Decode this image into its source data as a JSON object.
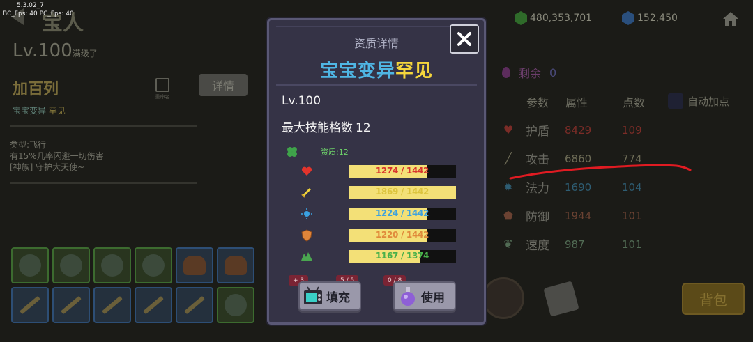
{
  "debug": {
    "version": "5.3.02_7",
    "fps": "BC_Fps: 40   PC_Fps: 40"
  },
  "background": {
    "title": "宝人",
    "currency": {
      "gold": "480,353,701",
      "gems": "152,450"
    },
    "pet": {
      "level": "Lv.100",
      "level_note": "满级了",
      "name": "加百列",
      "rename_label": "重命名",
      "detail_label": "详情",
      "subtitle": "宝宝变异",
      "subtitle_rare": "罕见",
      "desc": [
        "类型:飞行",
        "有15%几率闪避一切伤害",
        "[神族] 守护大天使~"
      ]
    },
    "attributes": {
      "remain_label": "剩余",
      "remain_value": "0",
      "headers": [
        "参数",
        "属性",
        "点数"
      ],
      "auto_add_label": "自动加点",
      "rows": [
        {
          "icon": "heart-icon",
          "name": "护盾",
          "value": "8429",
          "points": "109",
          "color": "#7b2c27"
        },
        {
          "icon": "sword-icon",
          "name": "攻击",
          "value": "6860",
          "points": "774",
          "color": "#6c6a55"
        },
        {
          "icon": "sun-icon",
          "name": "法力",
          "value": "1690",
          "points": "104",
          "color": "#2e5d73"
        },
        {
          "icon": "shield-icon",
          "name": "防御",
          "value": "1944",
          "points": "101",
          "color": "#6b4232"
        },
        {
          "icon": "leaf-icon",
          "name": "速度",
          "value": "987",
          "points": "101",
          "color": "#516b54"
        }
      ]
    },
    "bag_label": "背包"
  },
  "modal": {
    "title": "资质详情",
    "quality_part1": "宝宝变异",
    "quality_part2": "罕见",
    "level": "Lv.100",
    "max_slots_label": "最大技能格数",
    "max_slots_value": "12",
    "aptitude_label": "资质:12",
    "bars": [
      {
        "icon": "heart-icon",
        "text": "1274 / 1442",
        "fill": 0.73,
        "text_color": "#d8362d"
      },
      {
        "icon": "sword-icon",
        "text": "1869 / 1442",
        "fill": 1.0,
        "text_color": "#dcc43e"
      },
      {
        "icon": "sun-icon",
        "text": "1224 / 1442",
        "fill": 0.73,
        "text_color": "#3fa2dd"
      },
      {
        "icon": "shield-icon",
        "text": "1220 / 1442",
        "fill": 0.73,
        "text_color": "#e08a3b"
      },
      {
        "icon": "leaf-icon",
        "text": "1167 / 1374",
        "fill": 0.66,
        "text_color": "#48b04a"
      }
    ],
    "fill_button": {
      "label": "填充",
      "badge_left": "+ 3",
      "badge_right": "5 / 5"
    },
    "use_button": {
      "label": "使用",
      "badge": "0 / 8"
    }
  }
}
